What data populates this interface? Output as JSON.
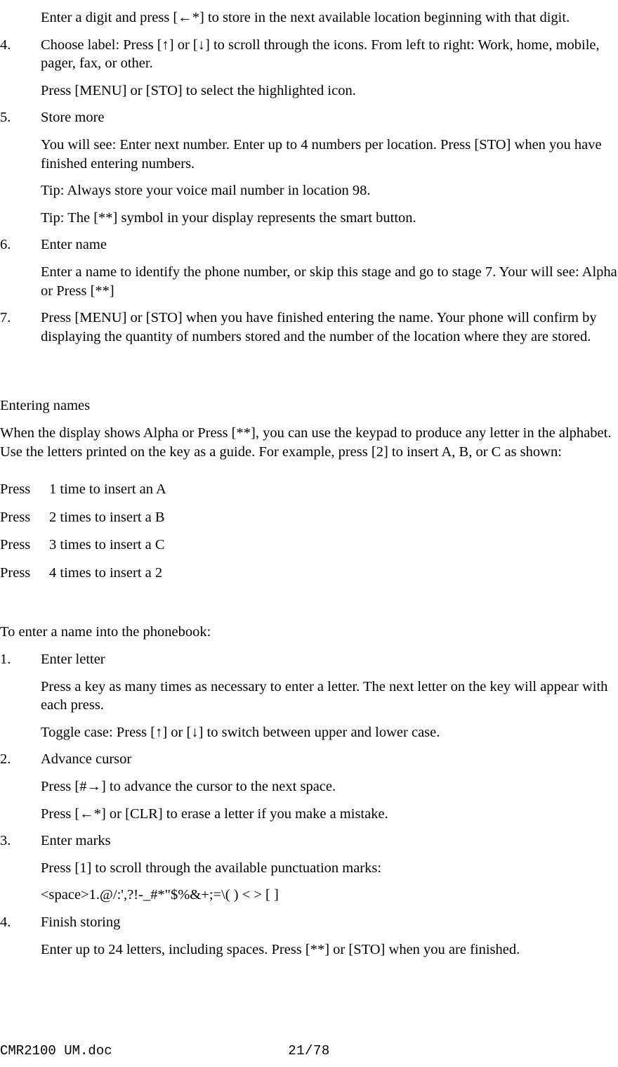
{
  "document": {
    "footer_file": "CMR2100 UM.doc",
    "footer_page": "21/78"
  },
  "phonebook_steps": {
    "step3_continuation": "Enter a digit and press [←*] to store in the next available location beginning with that digit.",
    "items": [
      {
        "number": "4.",
        "text": "Choose label: Press [↑] or [↓] to scroll through the icons. From left to right: Work, home, mobile, pager, fax, or other.",
        "sub": [
          "Press [MENU] or [STO] to select the highlighted icon."
        ]
      },
      {
        "number": "5.",
        "text": "Store more",
        "sub": [
          "You will see: Enter next number. Enter up to 4 numbers per location. Press [STO] when you have finished entering numbers.",
          "Tip:  Always store your voice mail number in location 98.",
          "Tip:  The [**] symbol in your display represents the smart button."
        ]
      },
      {
        "number": "6.",
        "text": "Enter name",
        "sub": [
          "Enter a name to identify the phone number, or skip this stage and go to stage 7. Your will see: Alpha or Press [**]"
        ]
      },
      {
        "number": "7.",
        "text": "Press [MENU] or [STO] when you have finished entering the name. Your phone will confirm by displaying the quantity of numbers stored and the number of the location where they are stored.",
        "sub": []
      }
    ]
  },
  "entering_names": {
    "heading": "Entering names",
    "intro": "When the display shows Alpha or Press [**], you can use the keypad to produce any letter in the alphabet. Use the letters printed on the key as a guide.  For example, press [2] to insert A, B, or C as shown:",
    "press_table": [
      {
        "label": "Press",
        "text": "1 time to insert an A"
      },
      {
        "label": "Press",
        "text": "2 times to insert a B"
      },
      {
        "label": "Press",
        "text": "3 times to insert a C"
      },
      {
        "label": "Press",
        "text": "4 times to insert a 2"
      }
    ]
  },
  "enter_name_procedure": {
    "lead_in": "To enter a name into the phonebook:",
    "items": [
      {
        "number": "1.",
        "text": "Enter letter",
        "sub": [
          "Press a key as many times as necessary to enter a letter. The next letter on the key will appear with each press.",
          "Toggle case: Press [↑] or [↓] to switch between upper and lower case."
        ]
      },
      {
        "number": "2.",
        "text": "Advance cursor",
        "sub": [
          "Press [#→] to advance the cursor to the next space.",
          "Press [←*] or [CLR] to erase a letter if you make a mistake."
        ]
      },
      {
        "number": "3.",
        "text": "Enter marks",
        "sub": [
          "Press [1] to scroll through the available punctuation marks:",
          "<space>1.@/:',?!-_#*\"$%&+;=\\( ) < > [ ]"
        ]
      },
      {
        "number": "4.",
        "text": "Finish storing",
        "sub": [
          "Enter up to 24 letters, including spaces. Press [**] or [STO] when you are finished."
        ]
      }
    ]
  }
}
